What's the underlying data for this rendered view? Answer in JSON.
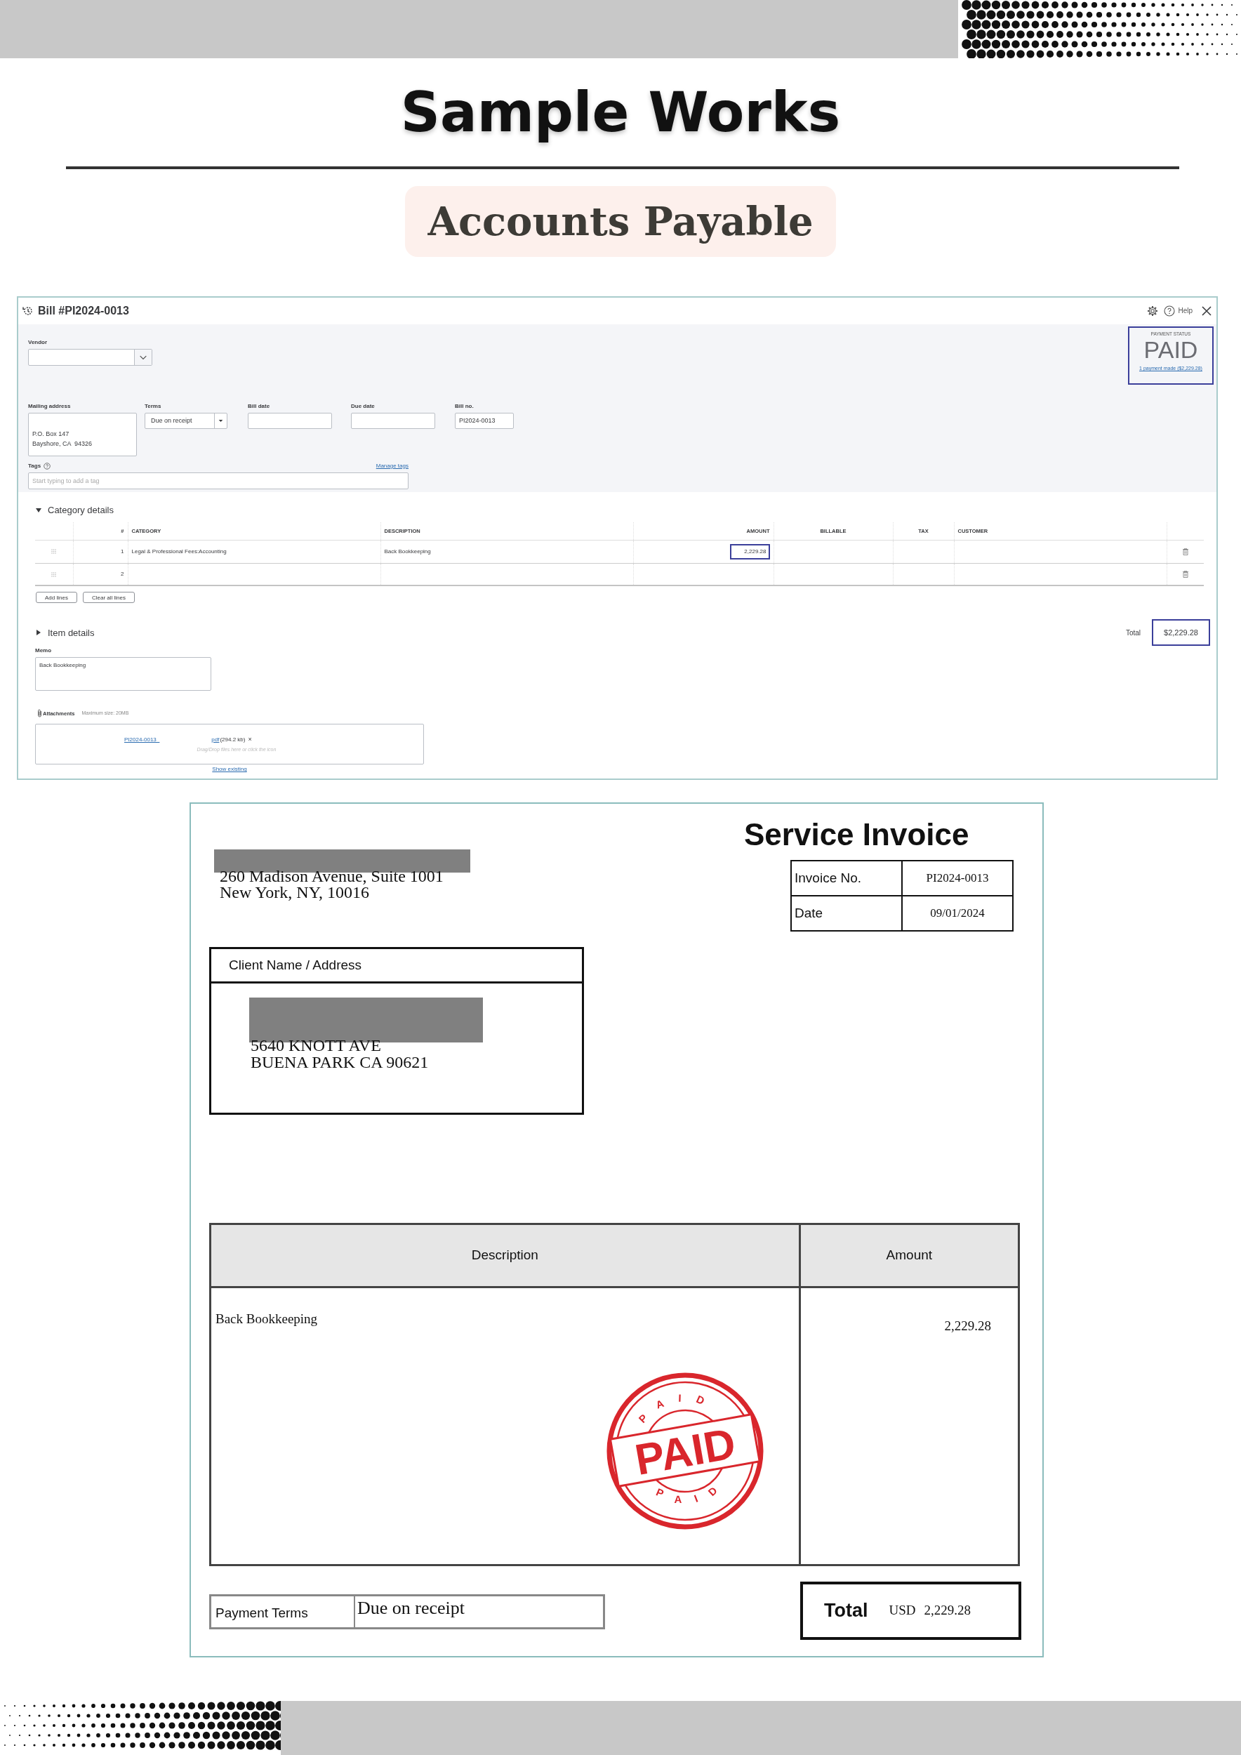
{
  "header": {
    "title": "Sample Works",
    "subtitle": "Accounts Payable"
  },
  "bill": {
    "title": "Bill #PI2024-0013",
    "help": "Help",
    "vendor": {
      "label": "Vendor"
    },
    "mailing_address": {
      "label": "Mailing address",
      "lines": [
        "P.O. Box 147",
        "Bayshore, CA  94326"
      ]
    },
    "terms": {
      "label": "Terms",
      "value": "Due on receipt"
    },
    "bill_date": {
      "label": "Bill date"
    },
    "due_date": {
      "label": "Due date"
    },
    "bill_no": {
      "label": "Bill no.",
      "value": "PI2024-0013"
    },
    "tags": {
      "label": "Tags",
      "manage": "Manage tags",
      "placeholder": "Start typing to add a tag"
    },
    "payment_status": {
      "label": "PAYMENT STATUS",
      "status": "PAID",
      "link": "1 payment made ($2,229.28)",
      "highlighted": true
    },
    "category_details": {
      "title": "Category details",
      "expanded": true,
      "columns": [
        "#",
        "CATEGORY",
        "DESCRIPTION",
        "AMOUNT",
        "BILLABLE",
        "TAX",
        "CUSTOMER"
      ],
      "rows": [
        {
          "number": "1",
          "category": "Legal & Professional Fees:Accounting",
          "description": "Back Bookkeeping",
          "amount": "2,229.28",
          "highlighted": true
        },
        {
          "number": "2",
          "highlighted": false
        }
      ]
    },
    "buttons": [
      "Add lines",
      "Clear all lines"
    ],
    "item_details": {
      "title": "Item details",
      "expanded": false
    },
    "total": {
      "label": "Total",
      "value": "$2,229.28",
      "highlighted": true
    },
    "memo": {
      "label": "Memo",
      "value": "Back Bookkeeping"
    },
    "attachments": {
      "label": "Attachments",
      "max_size": "Maximum size: 20MB",
      "file_name": "PI2024-0013_",
      "file_ext": "pdf",
      "file_size": "(294.2 kb)",
      "remove": "×",
      "hint": "Drag/Drop files here or click the icon",
      "show_existing": "Show existing"
    }
  },
  "invoice": {
    "title": "Service Invoice",
    "sender_lines": [
      "260 Madison Avenue, Suite 1001",
      "New York, NY, 10016"
    ],
    "details": [
      {
        "label": "Invoice No.",
        "value": "PI2024-0013"
      },
      {
        "label": "Date",
        "value": "09/01/2024"
      }
    ],
    "client": {
      "label": "Client Name / Address",
      "lines": [
        "5640 KNOTT AVE",
        "BUENA PARK CA 90621"
      ]
    },
    "columns": [
      "Description",
      "Amount"
    ],
    "items": [
      {
        "description": "Back Bookkeeping",
        "amount": "2,229.28"
      }
    ],
    "stamp": {
      "text": "PAID",
      "ring_top": "PAID",
      "ring_bottom": "PAID"
    },
    "payment_terms": {
      "label": "Payment Terms",
      "value": "Due on receipt"
    },
    "total": {
      "label": "Total",
      "currency": "USD",
      "value": "2,229.28"
    }
  }
}
